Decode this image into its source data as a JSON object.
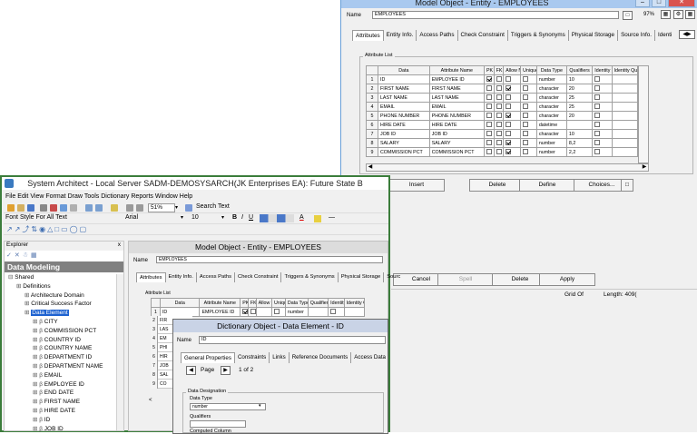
{
  "back_window": {
    "title": "Model Object - Entity - EMPLOYEES",
    "name_label": "Name",
    "name_value": "EMPLOYEES",
    "zoom": "97%",
    "tabs": [
      "Attributes",
      "Entity Info.",
      "Access Paths",
      "Check Constraint",
      "Triggers & Synonyms",
      "Physical Storage",
      "Source Info.",
      "Identi"
    ],
    "attribute_list_label": "Attribute List",
    "columns": [
      "Data",
      "Attribute Name",
      "PK",
      "FK",
      "Allow Null",
      "Unique",
      "Data Type",
      "Qualifiers",
      "Identity",
      "Identity Qual"
    ],
    "rows": [
      {
        "n": "1",
        "data": "ID",
        "attr": "EMPLOYEE ID",
        "pk": true,
        "fk": false,
        "null": false,
        "uniq": false,
        "type": "number",
        "qual": "10"
      },
      {
        "n": "2",
        "data": "FIRST NAME",
        "attr": "FIRST NAME",
        "pk": false,
        "fk": false,
        "null": true,
        "uniq": false,
        "type": "character",
        "qual": "20"
      },
      {
        "n": "3",
        "data": "LAST NAME",
        "attr": "LAST NAME",
        "pk": false,
        "fk": false,
        "null": false,
        "uniq": false,
        "type": "character",
        "qual": "25"
      },
      {
        "n": "4",
        "data": "EMAIL",
        "attr": "EMAIL",
        "pk": false,
        "fk": false,
        "null": false,
        "uniq": false,
        "type": "character",
        "qual": "25"
      },
      {
        "n": "5",
        "data": "PHONE NUMBER",
        "attr": "PHONE NUMBER",
        "pk": false,
        "fk": false,
        "null": true,
        "uniq": false,
        "type": "character",
        "qual": "20"
      },
      {
        "n": "6",
        "data": "HIRE DATE",
        "attr": "HIRE DATE",
        "pk": false,
        "fk": false,
        "null": false,
        "uniq": false,
        "type": "datetime",
        "qual": ""
      },
      {
        "n": "7",
        "data": "JOB ID",
        "attr": "JOB ID",
        "pk": false,
        "fk": false,
        "null": false,
        "uniq": false,
        "type": "character",
        "qual": "10"
      },
      {
        "n": "8",
        "data": "SALARY",
        "attr": "SALARY",
        "pk": false,
        "fk": false,
        "null": true,
        "uniq": false,
        "type": "number",
        "qual": "8,2"
      },
      {
        "n": "9",
        "data": "COMMISSION PCT",
        "attr": "COMMISSION PCT",
        "pk": false,
        "fk": false,
        "null": true,
        "uniq": false,
        "type": "number",
        "qual": "2,2"
      }
    ],
    "buttons": [
      "Insert",
      "Delete",
      "Define",
      "Choices..."
    ],
    "bottom_buttons": [
      "Cancel",
      "Spell",
      "Delete",
      "Apply"
    ],
    "status_grid": "Grid Of",
    "status_length": "Length: 409("
  },
  "front_window": {
    "title": "System Architect - Local Server SADM-DEMOSYSARCH(JK Enterprises EA): Future State B",
    "menu": [
      "File",
      "Edit",
      "View",
      "Format",
      "Draw",
      "Tools",
      "Dictionary",
      "Reports",
      "Window",
      "Help"
    ],
    "zoom": "51%",
    "search_text": "Search Text",
    "font_style_label": "Font Style For All Text",
    "font_name": "Arial",
    "font_size": "10",
    "explorer_label": "Explorer",
    "explorer_pin": " x",
    "data_modeling": "Data Modeling",
    "tree": [
      {
        "label": "Shared",
        "indent": 0
      },
      {
        "label": "Definitions",
        "indent": 1
      },
      {
        "label": "Architecture Domain",
        "indent": 2
      },
      {
        "label": "Critical Success Factor",
        "indent": 2
      },
      {
        "label": "Data Element",
        "indent": 2,
        "selected": true
      },
      {
        "label": "CITY",
        "indent": 3
      },
      {
        "label": "COMMISSION PCT",
        "indent": 3
      },
      {
        "label": "COUNTRY ID",
        "indent": 3
      },
      {
        "label": "COUNTRY NAME",
        "indent": 3
      },
      {
        "label": "DEPARTMENT ID",
        "indent": 3
      },
      {
        "label": "DEPARTMENT NAME",
        "indent": 3
      },
      {
        "label": "EMAIL",
        "indent": 3
      },
      {
        "label": "EMPLOYEE ID",
        "indent": 3
      },
      {
        "label": "END DATE",
        "indent": 3
      },
      {
        "label": "FIRST NAME",
        "indent": 3
      },
      {
        "label": "HIRE DATE",
        "indent": 3
      },
      {
        "label": "ID",
        "indent": 3
      },
      {
        "label": "JOB ID",
        "indent": 3
      }
    ],
    "inner_title": "Model Object - Entity - EMPLOYEES",
    "inner_name_label": "Name",
    "inner_name_value": "EMPLOYEES",
    "inner_tabs": [
      "Attributes",
      "Entity Info.",
      "Access Paths",
      "Check Constraint",
      "Triggers & Synonyms",
      "Physical Storage",
      "Sourc"
    ],
    "inner_attr_list": "Attribute List",
    "inner_columns": [
      "Data",
      "Attribute Name",
      "PK",
      "FK",
      "Allow Null",
      "Unique",
      "Data Type",
      "Qualifiers",
      "Identity",
      "Identity Qual"
    ],
    "inner_row1": {
      "data": "ID",
      "attr": "EMPLOYEE ID",
      "type": "number",
      "qual": "10"
    },
    "inner_row_stubs": [
      "FIR",
      "LAS",
      "EM",
      "PHI",
      "HIR",
      "JOB",
      "SAL",
      "CO"
    ],
    "dialog": {
      "title": "Dictionary Object - Data Element - ID",
      "name_label": "Name",
      "name_value": "ID",
      "tabs": [
        "General Properties",
        "Constraints",
        "Links",
        "Reference Documents",
        "Access Data"
      ],
      "page_label": "Page",
      "page_of": "1 of 2",
      "designation": "Data Designation",
      "data_type_label": "Data Type",
      "data_type_value": "number",
      "qualifiers_label": "Qualifiers",
      "computed_label": "Computed Column"
    }
  }
}
